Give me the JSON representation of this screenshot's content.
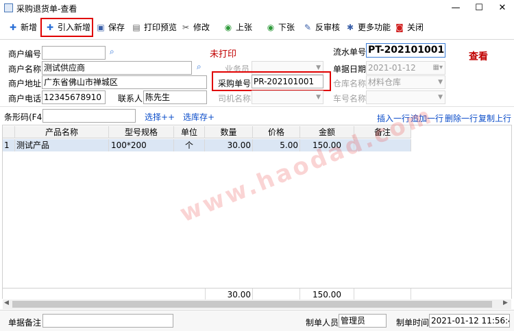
{
  "window": {
    "title": "采购退货单-查看",
    "minimize": "—",
    "maximize": "☐",
    "close": "✕"
  },
  "toolbar": {
    "add": "新增",
    "import_add": "引入新增",
    "save": "保存",
    "print_preview": "打印预览",
    "edit": "修改",
    "prev": "上张",
    "next": "下张",
    "unapprove": "反审核",
    "more": "更多功能",
    "close": "关闭"
  },
  "form": {
    "merchant_code_label": "商户编号",
    "merchant_code": "",
    "merchant_name_label": "商户名称",
    "merchant_name": "测试供应商",
    "merchant_addr_label": "商户地址",
    "merchant_addr": "广东省佛山市禅城区",
    "merchant_phone_label": "商户电话",
    "merchant_phone": "12345678910",
    "contact_label": "联系人",
    "contact": "陈先生",
    "print_status": "未打印",
    "salesman_label": "业务员",
    "salesman": "",
    "purchase_no_label": "采购单号",
    "purchase_no": "PR-202101001",
    "driver_label": "司机名称",
    "driver": "",
    "serial_label": "流水单号",
    "serial": "PT-202101001",
    "view_mode": "查看",
    "date_label": "单据日期",
    "date": "2021-01-12",
    "warehouse_label": "仓库名称",
    "warehouse": "材料仓库",
    "plate_label": "车号名称",
    "plate": ""
  },
  "barcode": {
    "label": "条形码(F4)",
    "value": "",
    "choose": "选择++",
    "choose_stock": "选库存+"
  },
  "row_actions": {
    "insert": "插入一行",
    "append": "追加一行",
    "delete": "删除一行",
    "copy": "复制上行"
  },
  "grid": {
    "headers": [
      "",
      "产品名称",
      "型号规格",
      "单位",
      "数量",
      "价格",
      "金额",
      "备注"
    ],
    "rows": [
      [
        "1",
        "测试产品",
        "100*200",
        "个",
        "30.00",
        "5.00",
        "150.00",
        ""
      ]
    ],
    "totals": {
      "quantity": "30.00",
      "amount": "150.00"
    }
  },
  "watermark": "www.haodad.com",
  "bottom": {
    "remark_label": "单据备注",
    "remark": "",
    "maker_label": "制单人员",
    "maker": "管理员",
    "time_label": "制单时间",
    "time": "2021-01-12 11:56:41"
  },
  "colors": {
    "highlight_red": "#e00000",
    "link_blue": "#0a4cc9",
    "status_red": "#c00000"
  }
}
